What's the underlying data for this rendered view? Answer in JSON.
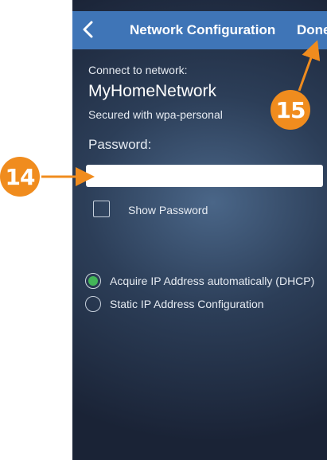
{
  "navbar": {
    "title": "Network Configuration",
    "done_label": "Done"
  },
  "content": {
    "connect_label": "Connect to network:",
    "network_name": "MyHomeNetwork",
    "security": "Secured with wpa-personal",
    "password_label": "Password:",
    "password_value": "",
    "show_password_label": "Show Password",
    "show_password_checked": false,
    "ip_options": [
      {
        "label": "Acquire IP Address automatically (DHCP)",
        "selected": true
      },
      {
        "label": "Static IP Address Configuration",
        "selected": false
      }
    ]
  },
  "callouts": {
    "password_field": "14",
    "done_button": "15"
  },
  "colors": {
    "navbar": "#3f75b7",
    "callout": "#f08c1e",
    "radio_selected": "#43b558"
  },
  "icons": {
    "back": "chevron-left-icon"
  }
}
